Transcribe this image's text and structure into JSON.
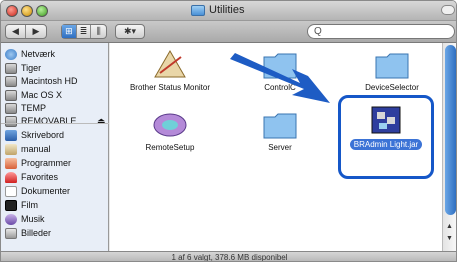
{
  "window": {
    "title": "Utilities"
  },
  "toolbar": {
    "back": "◀",
    "forward": "▶",
    "view_icon": "⊞",
    "view_list": "≣",
    "view_column": "⫼",
    "action": "✱▾",
    "search_placeholder": "Q"
  },
  "sidebar": {
    "items": [
      {
        "label": "Netværk",
        "icon": "network-icon"
      },
      {
        "label": "Tiger",
        "icon": "disk-icon"
      },
      {
        "label": "Macintosh HD",
        "icon": "disk-icon"
      },
      {
        "label": "Mac OS X",
        "icon": "disk-icon"
      },
      {
        "label": "TEMP",
        "icon": "disk-icon"
      },
      {
        "label": "REMOVABLE",
        "icon": "disk-icon",
        "eject": "⏏"
      },
      {
        "label": "Skrivebord",
        "icon": "desktop-icon"
      },
      {
        "label": "manual",
        "icon": "home-icon"
      },
      {
        "label": "Programmer",
        "icon": "applications-icon"
      },
      {
        "label": "Favorites",
        "icon": "favorites-icon"
      },
      {
        "label": "Dokumenter",
        "icon": "documents-icon"
      },
      {
        "label": "Film",
        "icon": "movies-icon"
      },
      {
        "label": "Musik",
        "icon": "music-icon"
      },
      {
        "label": "Billeder",
        "icon": "pictures-icon"
      }
    ]
  },
  "files": [
    {
      "label": "Brother Status Monitor",
      "icon": "app-icon"
    },
    {
      "label": "ControlC",
      "icon": "folder-icon"
    },
    {
      "label": "DeviceSelector",
      "icon": "folder-icon"
    },
    {
      "label": "RemoteSetup",
      "icon": "app-icon"
    },
    {
      "label": "Server",
      "icon": "folder-icon"
    },
    {
      "label": "BRAdmin Light.jar",
      "icon": "jar-icon",
      "selected": true
    }
  ],
  "status": "1 af 6 valgt, 378.6 MB disponibel",
  "colors": {
    "selection": "#1557c8",
    "arrow": "#1e5cc4"
  }
}
